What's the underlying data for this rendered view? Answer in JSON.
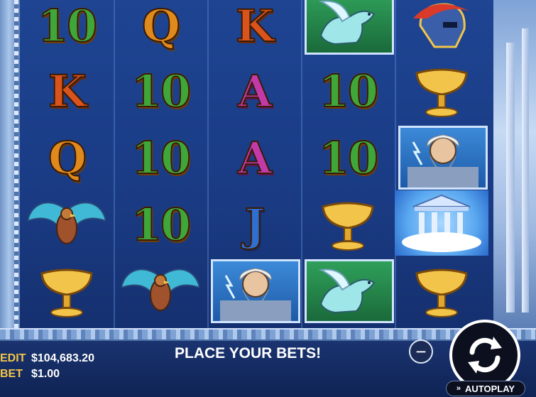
{
  "game": {
    "reels": [
      [
        "10",
        "K",
        "Q",
        "eagle",
        "cup"
      ],
      [
        "Q",
        "10",
        "10",
        "10",
        "eagle"
      ],
      [
        "K",
        "A",
        "A",
        "J",
        "zeus"
      ],
      [
        "pegasus",
        "10",
        "10",
        "cup",
        "pegasus"
      ],
      [
        "helmet",
        "cup",
        "zeus",
        "temple",
        "cup"
      ]
    ]
  },
  "hud": {
    "credit_label": "EDIT",
    "credit_value": "$104,683.20",
    "bet_label": "BET",
    "bet_value": "$1.00",
    "message": "PLACE YOUR BETS!",
    "minus_icon": "minus-icon",
    "spin_icon": "refresh-arrows-icon",
    "autoplay_label": "AUTOPLAY",
    "autoplay_icon": "double-chevron-icon"
  },
  "colors": {
    "reel_background": "#1a3b84",
    "gold_text": "#f2c54a",
    "spin_button": "#0b0f1e"
  }
}
